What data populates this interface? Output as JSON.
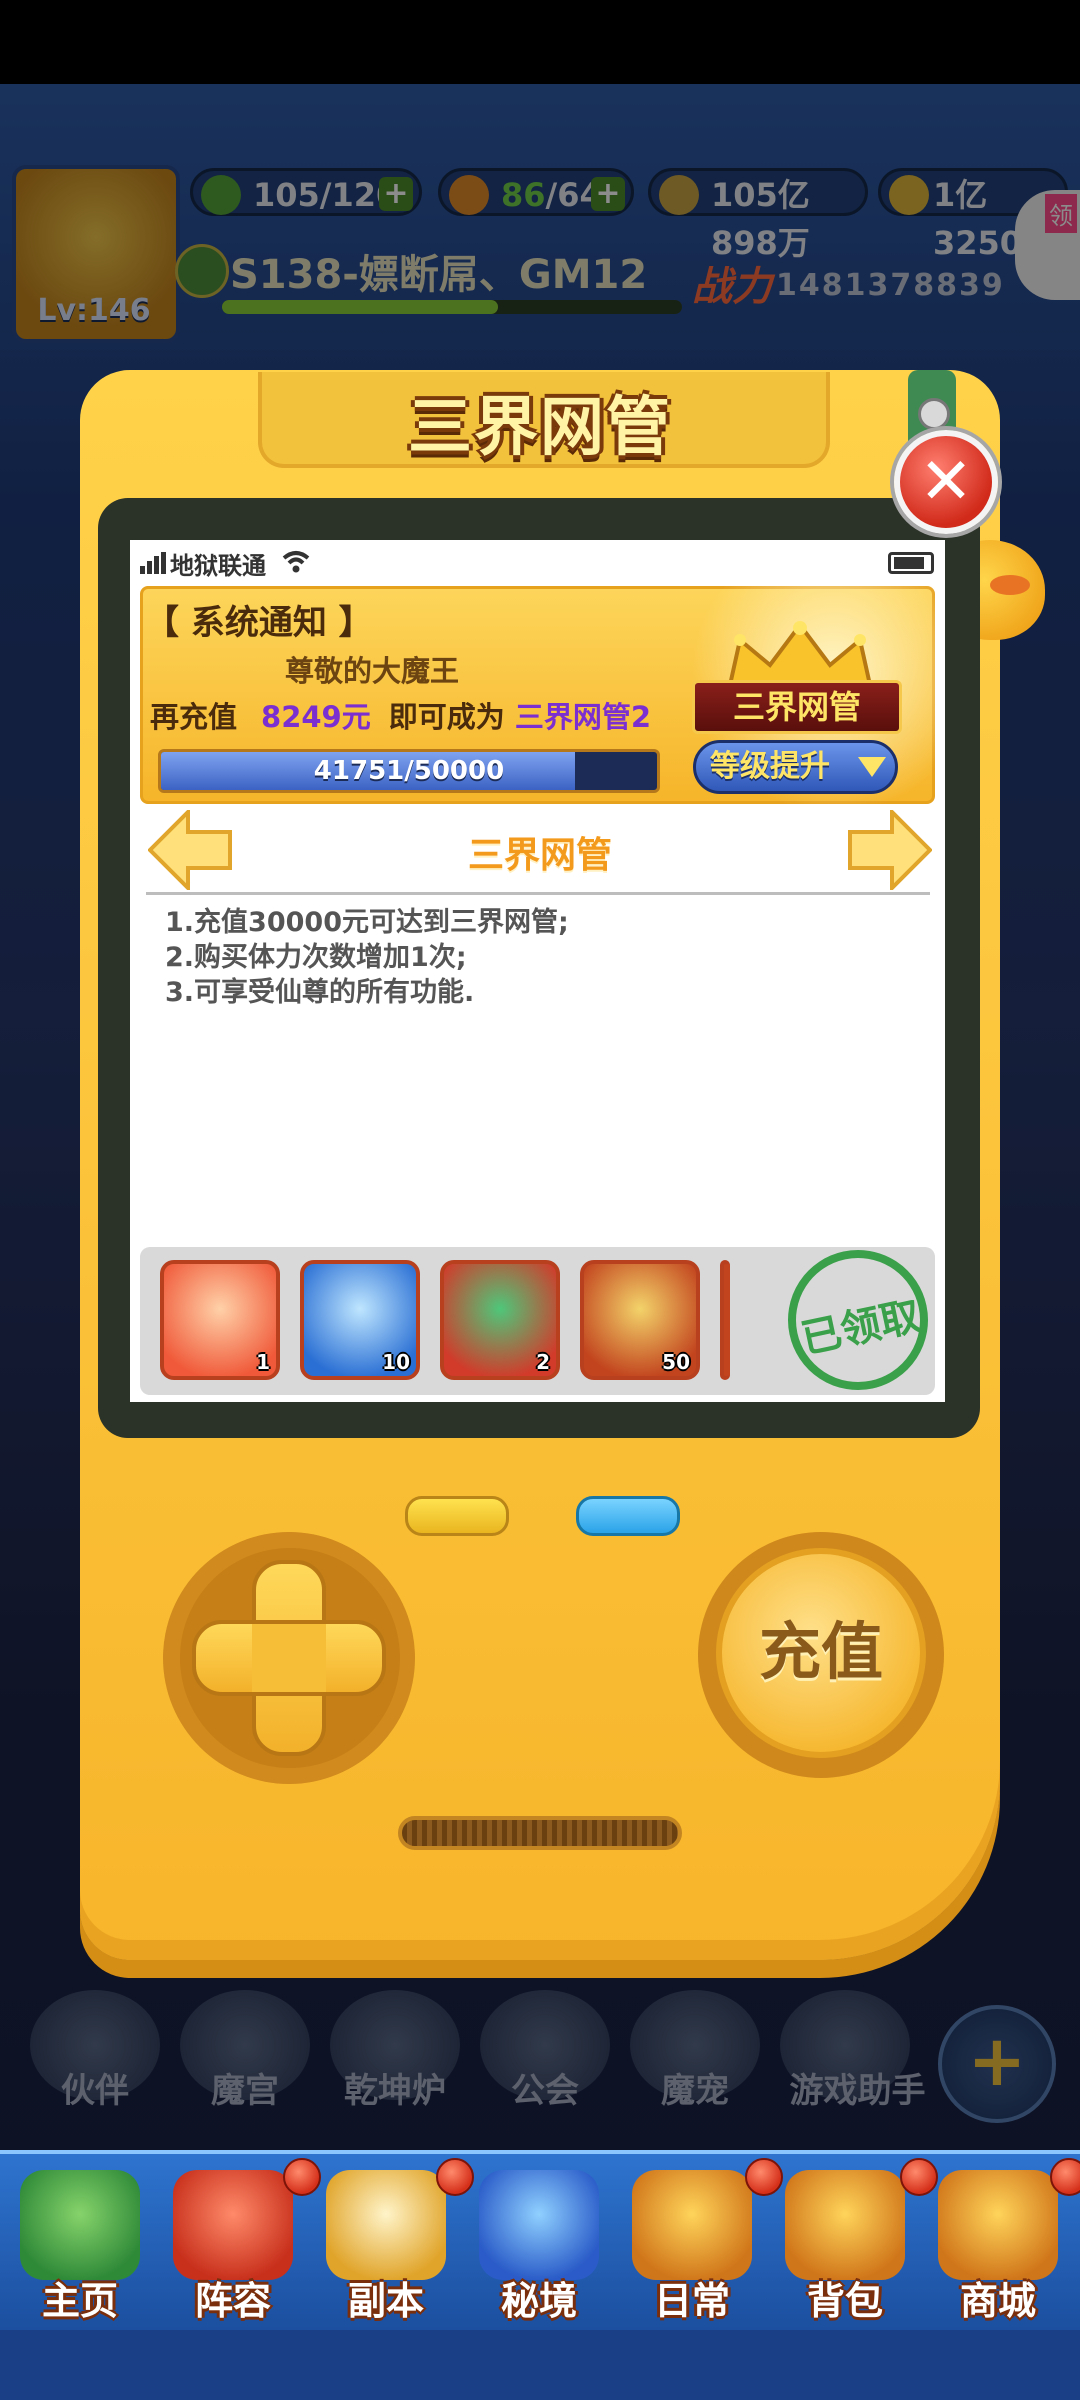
{
  "hud": {
    "stamina": "105/120",
    "kills_a": "86",
    "kills_b": "/64",
    "gold": "105亿898万",
    "diamond": "1亿3250万",
    "server_name": "S138-嫖断屌、GM12",
    "power_label": "战力",
    "power_value": "1481378839",
    "level": "Lv:146",
    "corner_text": "领"
  },
  "popup": {
    "title": "三界网管",
    "close_glyph": "✕",
    "status_bar": {
      "carrier": "地狱联通"
    },
    "notice": {
      "title": "【 系统通知 】",
      "greeting": "尊敬的大魔王",
      "line_prefix": "再充值",
      "amount": "8249元",
      "line_mid": "即可成为",
      "next_rank": "三界网管2",
      "progress_text": "41751/50000",
      "progress_fraction": 0.835,
      "rank_badge": "三界网管",
      "upgrade_label": "等级提升"
    },
    "rank_nav": {
      "title": "三界网管"
    },
    "description": [
      "1.充值30000元可达到三界网管;",
      "2.购买体力次数增加1次;",
      "3.可享受仙尊的所有功能."
    ],
    "rewards": [
      {
        "name": "character-card",
        "count": "1",
        "color": "#f05a3a"
      },
      {
        "name": "ice-shark-card",
        "count": "10",
        "color": "#2a6fd4"
      },
      {
        "name": "lucky-bag-card",
        "count": "2",
        "color": "#d23a2a"
      },
      {
        "name": "golden-dragon-card",
        "count": "50",
        "color": "#c2441e"
      }
    ],
    "claimed_stamp": "已领取",
    "charge_label": "充值"
  },
  "bottom_row": [
    "伙伴",
    "魔宫",
    "乾坤炉",
    "公会",
    "魔宠",
    "游戏助手"
  ],
  "tabs": [
    {
      "label": "主页"
    },
    {
      "label": "阵容"
    },
    {
      "label": "副本"
    },
    {
      "label": "秘境"
    },
    {
      "label": "日常"
    },
    {
      "label": "背包"
    },
    {
      "label": "商城"
    }
  ],
  "colors": {
    "accent_yellow": "#f7b52b",
    "rank_purple": "#7b2fd0",
    "stamp_green": "#3aa04a"
  }
}
